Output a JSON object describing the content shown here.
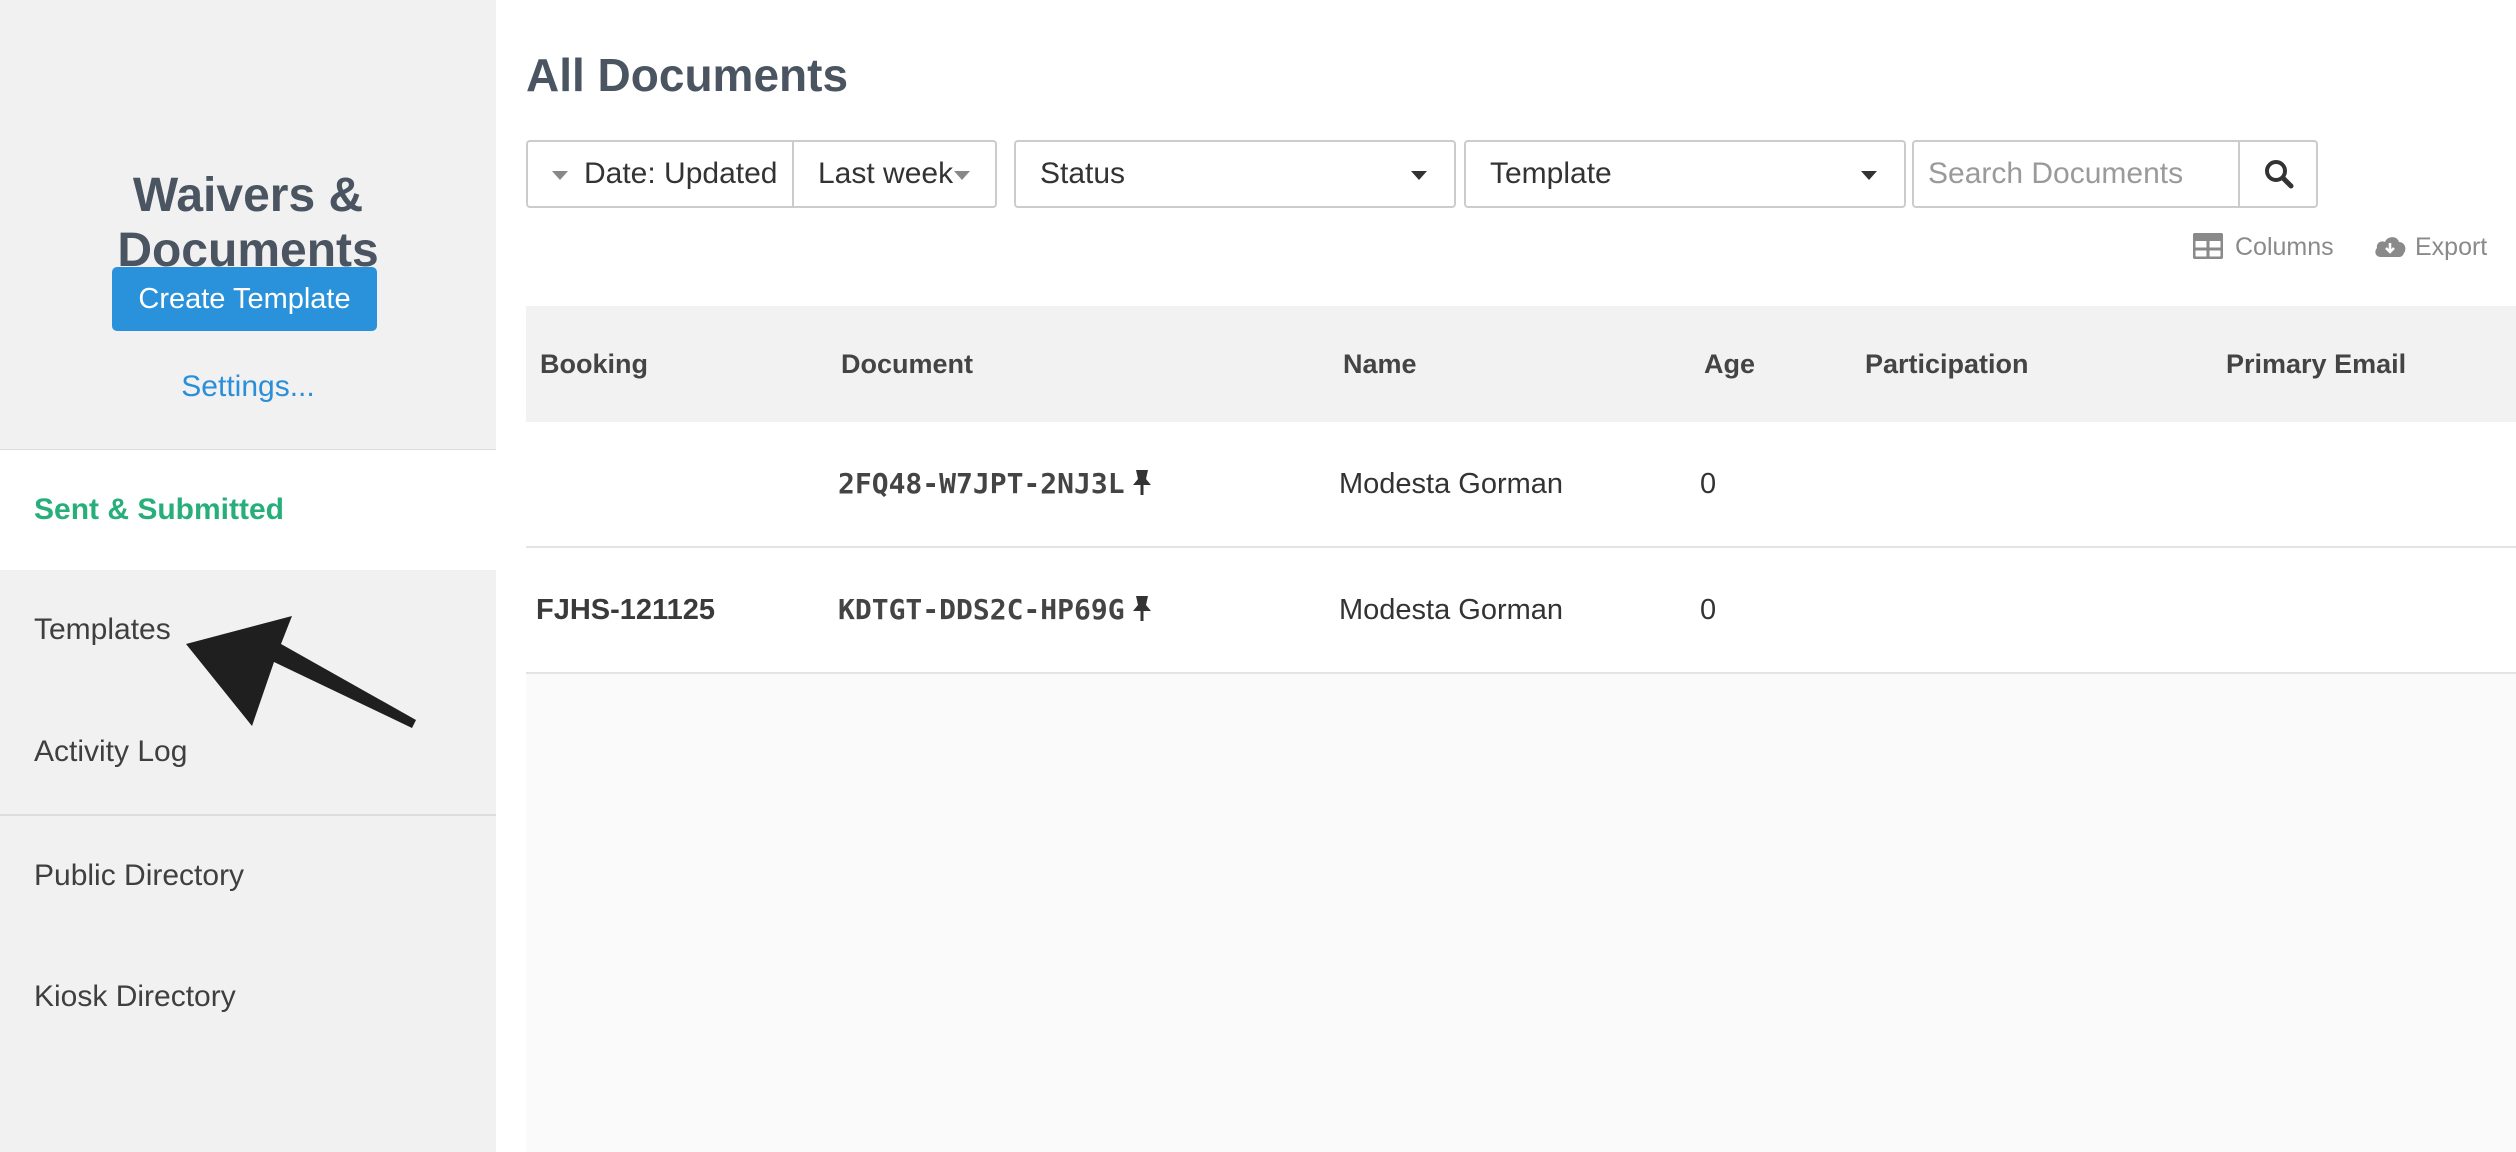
{
  "sidebar": {
    "title": "Waivers & Documents",
    "create_button": "Create Template",
    "settings_link": "Settings...",
    "items": [
      {
        "label": "Sent & Submitted",
        "active": true
      },
      {
        "label": "Templates",
        "active": false
      },
      {
        "label": "Activity Log",
        "active": false
      },
      {
        "label": "Public Directory",
        "active": false
      },
      {
        "label": "Kiosk Directory",
        "active": false
      }
    ]
  },
  "main": {
    "title": "All Documents",
    "filters": {
      "date_field": "Date: Updated",
      "date_range": "Last week",
      "status": "Status",
      "template": "Template"
    },
    "search": {
      "placeholder": "Search Documents",
      "value": "",
      "icon": "search-icon"
    },
    "tools": {
      "columns": "Columns",
      "export": "Export"
    },
    "table": {
      "headers": [
        "Booking",
        "Document",
        "Name",
        "Age",
        "Participation",
        "Primary Email"
      ],
      "rows": [
        {
          "booking": "",
          "document": "2FQ48-W7JPT-2NJ3L",
          "name": "Modesta Gorman",
          "age": "0",
          "participation": "",
          "primary_email": ""
        },
        {
          "booking": "FJHS-121125",
          "document": "KDTGT-DDS2C-HP69G",
          "name": "Modesta Gorman",
          "age": "0",
          "participation": "",
          "primary_email": ""
        }
      ]
    }
  },
  "colors": {
    "accent": "#2a92db",
    "active_nav": "#27ae7a",
    "title": "#4a5561"
  }
}
